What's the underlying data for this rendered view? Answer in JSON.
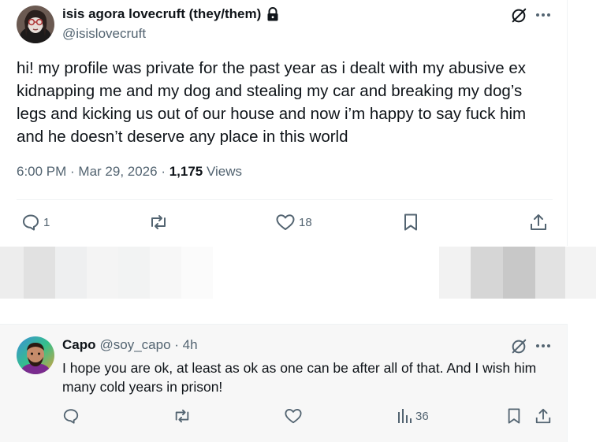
{
  "post": {
    "author_name": "isis agora lovecruft (they/them)",
    "author_handle": "@isislovecruft",
    "lock_icon": "lock-icon",
    "text": "hi! my profile was private for the past year as i dealt with my abusive ex kidnapping me and my dog and stealing my car and breaking my dog’s legs and kicking us out of our house and now i’m happy to say fuck him and he doesn’t deserve any place in this world",
    "time": "6:00 PM",
    "separator": " · ",
    "date": "Mar 29, 2026",
    "views_count": "1,175",
    "views_label": " Views",
    "actions": {
      "reply_count": "1",
      "repost_count": "",
      "like_count": "18"
    }
  },
  "reply": {
    "author_name": "Capo",
    "author_handle": "@soy_capo",
    "time_ago": "4h",
    "separator": " · ",
    "text": "I hope you are ok, at least as ok as one can be after all of that. And I wish him many cold years in prison!",
    "actions": {
      "views_count": "36"
    }
  },
  "colors": {
    "text_primary": "#0f1419",
    "text_secondary": "#536471",
    "divider": "#eff3f4",
    "reply_background": "#f7f7f7"
  }
}
